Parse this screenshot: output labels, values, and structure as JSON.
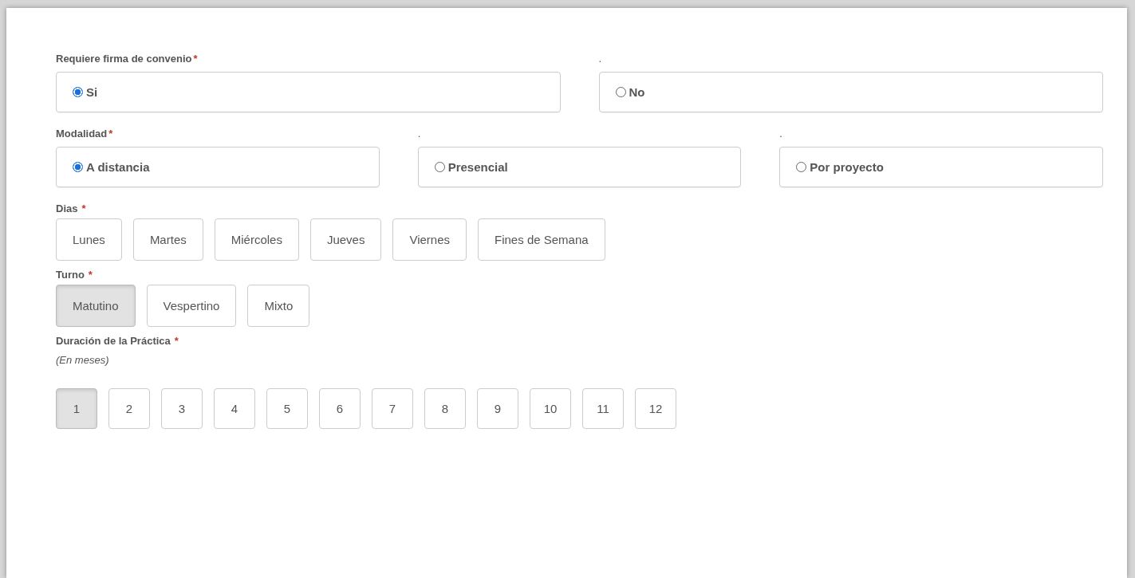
{
  "radio_groups": [
    {
      "options": [
        {
          "heading": "Requiere firma de convenio",
          "required": "*",
          "label": "Si",
          "selected": true
        },
        {
          "heading": ".",
          "label": "No",
          "selected": false
        }
      ]
    },
    {
      "options": [
        {
          "heading": "Modalidad",
          "required": "*",
          "label": "A distancia",
          "selected": true
        },
        {
          "heading": ".",
          "label": "Presencial",
          "selected": false
        },
        {
          "heading": ".",
          "label": "Por proyecto",
          "selected": false
        }
      ]
    }
  ],
  "button_groups": [
    {
      "label": "Dias",
      "required": "*",
      "buttons": [
        {
          "label": "Lunes",
          "selected": false
        },
        {
          "label": "Martes",
          "selected": false
        },
        {
          "label": "Miércoles",
          "selected": false
        },
        {
          "label": "Jueves",
          "selected": false
        },
        {
          "label": "Viernes",
          "selected": false
        },
        {
          "label": "Fines de Semana",
          "selected": false
        }
      ]
    },
    {
      "label": "Turno",
      "required": "*",
      "buttons": [
        {
          "label": "Matutino",
          "selected": true
        },
        {
          "label": "Vespertino",
          "selected": false
        },
        {
          "label": "Mixto",
          "selected": false
        }
      ]
    },
    {
      "label": "Duración de la Práctica",
      "required": "*",
      "note": "(En meses)",
      "buttons": [
        {
          "label": "1",
          "selected": true
        },
        {
          "label": "2",
          "selected": false
        },
        {
          "label": "3",
          "selected": false
        },
        {
          "label": "4",
          "selected": false
        },
        {
          "label": "5",
          "selected": false
        },
        {
          "label": "6",
          "selected": false
        },
        {
          "label": "7",
          "selected": false
        },
        {
          "label": "8",
          "selected": false
        },
        {
          "label": "9",
          "selected": false
        },
        {
          "label": "10",
          "selected": false
        },
        {
          "label": "11",
          "selected": false
        },
        {
          "label": "12",
          "selected": false
        }
      ]
    }
  ]
}
